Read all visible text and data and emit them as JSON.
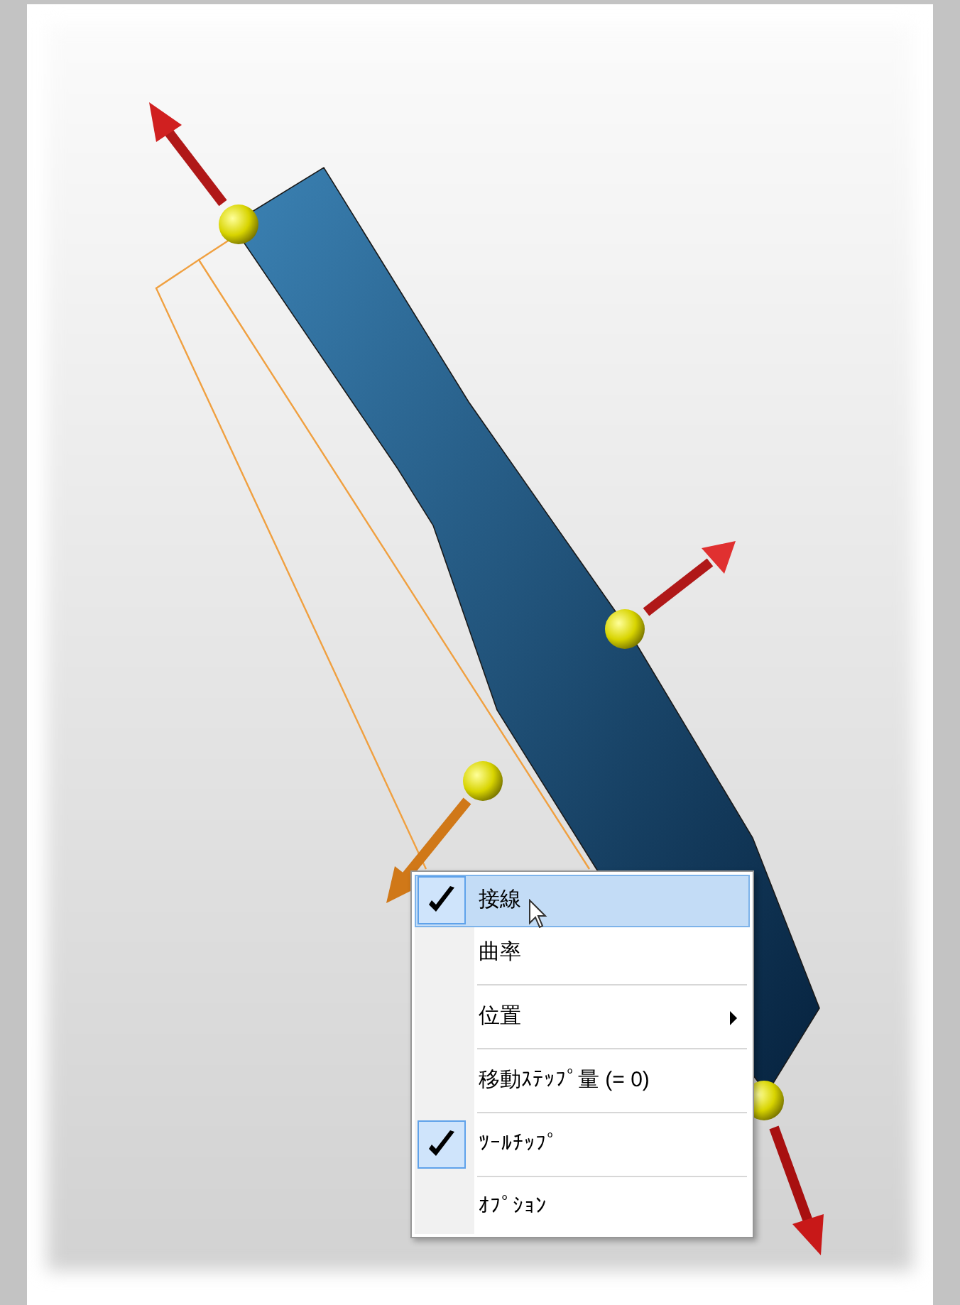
{
  "context_menu": {
    "items": [
      {
        "kind": "item",
        "label": "接線",
        "checked": true,
        "selected": true,
        "submenu": false
      },
      {
        "kind": "item",
        "label": "曲率",
        "checked": false,
        "selected": false,
        "submenu": false
      },
      {
        "kind": "separator"
      },
      {
        "kind": "item",
        "label": "位置",
        "checked": false,
        "selected": false,
        "submenu": true
      },
      {
        "kind": "separator"
      },
      {
        "kind": "item",
        "label": "移動ｽﾃｯﾌﾟ量 (= 0)",
        "checked": false,
        "selected": false,
        "submenu": false
      },
      {
        "kind": "separator"
      },
      {
        "kind": "item",
        "label": "ﾂｰﾙﾁｯﾌﾟ",
        "checked": true,
        "selected": false,
        "submenu": false
      },
      {
        "kind": "separator"
      },
      {
        "kind": "item",
        "label": "ｵﾌﾟｼｮﾝ",
        "checked": false,
        "selected": false,
        "submenu": false
      }
    ]
  }
}
